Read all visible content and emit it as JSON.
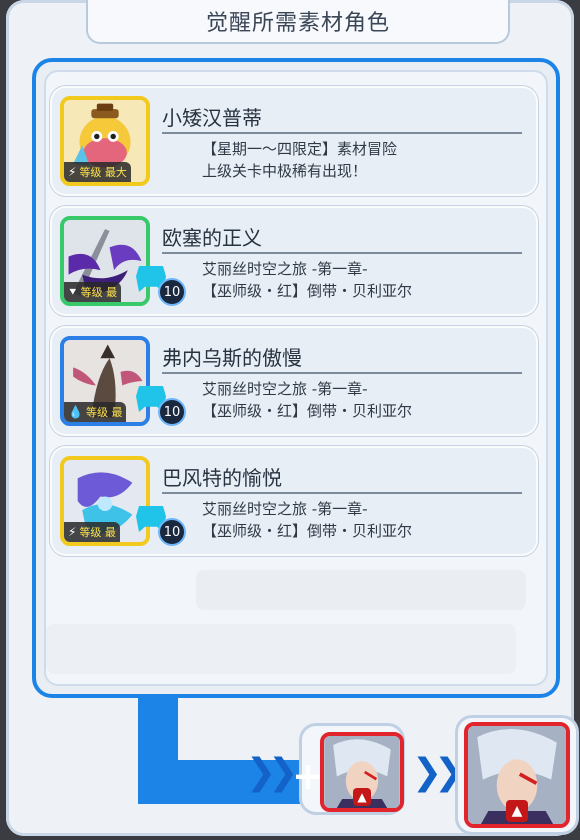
{
  "title": "觉醒所需素材角色",
  "cards": [
    {
      "name": "小矮汉普蒂",
      "level_tag": "等级 最大",
      "element": "⚡",
      "desc1": "【星期一～四限定】素材冒险",
      "desc2": "上级关卡中极稀有出现！",
      "color": "#f2c91d"
    },
    {
      "name": "欧塞的正义",
      "level_tag": "等级 最",
      "element": "⯆",
      "level": "10",
      "desc1": "艾丽丝时空之旅 -第一章-",
      "desc2": "【巫师级・红】倒带・贝利亚尔",
      "color": "#38c96a"
    },
    {
      "name": "弗内乌斯的傲慢",
      "level_tag": "等级 最",
      "element": "💧",
      "level": "10",
      "desc1": "艾丽丝时空之旅 -第一章-",
      "desc2": "【巫师级・红】倒带・贝利亚尔",
      "color": "#2b7fe6"
    },
    {
      "name": "巴风特的愉悦",
      "level_tag": "等级 最",
      "element": "⚡",
      "level": "10",
      "desc1": "艾丽丝时空之旅 -第一章-",
      "desc2": "【巫师级・红】倒带・贝利亚尔",
      "color": "#f2c91d"
    }
  ],
  "bottom": {
    "arrow_glyph": "❯❯",
    "plus_glyph": "+"
  }
}
